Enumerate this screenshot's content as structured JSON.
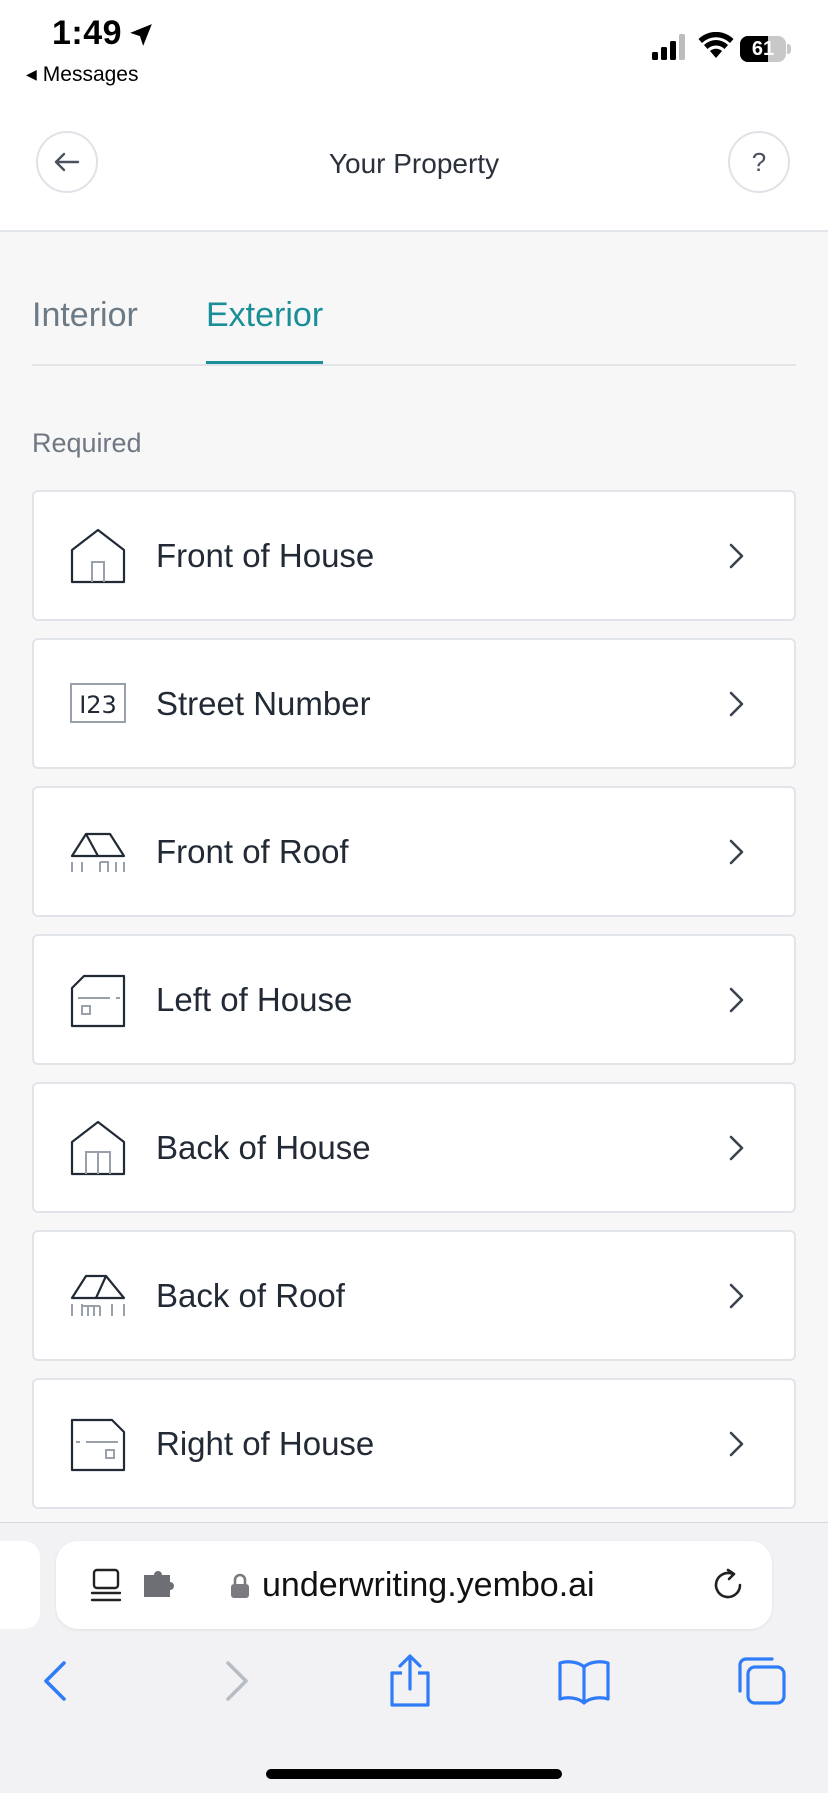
{
  "status_bar": {
    "time": "1:49",
    "back_app": "Messages",
    "battery": 61
  },
  "header": {
    "title": "Your Property",
    "help_label": "?"
  },
  "tabs": [
    {
      "label": "Interior",
      "active": false
    },
    {
      "label": "Exterior",
      "active": true
    }
  ],
  "section": {
    "label": "Required"
  },
  "items": [
    {
      "label": "Front of House",
      "icon": "house-front-icon"
    },
    {
      "label": "Street Number",
      "icon": "street-number-icon",
      "icon_text": "I23"
    },
    {
      "label": "Front of Roof",
      "icon": "roof-front-icon"
    },
    {
      "label": "Left of House",
      "icon": "house-left-icon"
    },
    {
      "label": "Back of House",
      "icon": "house-back-icon"
    },
    {
      "label": "Back of Roof",
      "icon": "roof-back-icon"
    },
    {
      "label": "Right of House",
      "icon": "house-right-icon"
    }
  ],
  "browser": {
    "url": "underwriting.yembo.ai"
  },
  "colors": {
    "accent": "#1a8f97",
    "safari_blue": "#2f7cf6"
  }
}
